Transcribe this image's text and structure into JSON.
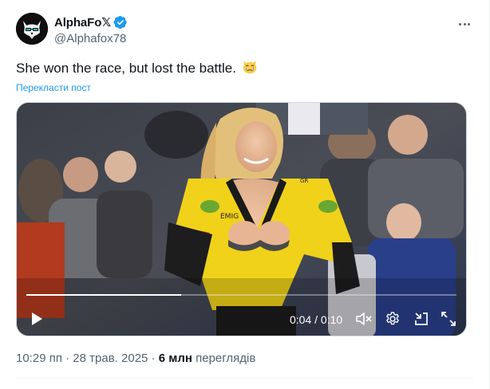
{
  "author": {
    "display_name": "AlphaFo𝕏",
    "handle": "@Alphafox78",
    "verified": true,
    "avatar_icon": "fox-with-glasses-avatar"
  },
  "tweet": {
    "text": "She won the race, but lost the battle.",
    "emoji_icon": "crying-cat-face-icon",
    "translate_label": "Перекласти пост"
  },
  "video": {
    "watermark": "...",
    "current_time": "0:04",
    "separator": "/",
    "duration": "0:10",
    "progress_fraction": 0.36,
    "icons": [
      "play-icon",
      "mute-icon",
      "settings-icon",
      "minimize-icon",
      "fullscreen-icon"
    ]
  },
  "meta": {
    "time": "10:29 пп",
    "dot": "·",
    "date": "28 трав. 2025",
    "views_count": "6 млн",
    "views_label": "переглядів"
  },
  "colors": {
    "accent": "#1d9bf0",
    "secondary_text": "#536471",
    "verified": "#1d9bf0"
  }
}
